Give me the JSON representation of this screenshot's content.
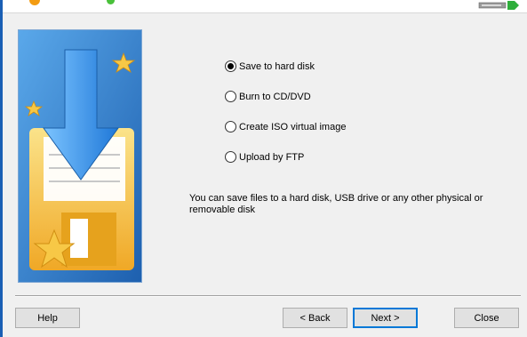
{
  "options": [
    {
      "label": "Save to hard disk",
      "checked": true
    },
    {
      "label": "Burn to CD/DVD",
      "checked": false
    },
    {
      "label": "Create ISO virtual image",
      "checked": false
    },
    {
      "label": "Upload by FTP",
      "checked": false
    }
  ],
  "description": "You can save files to a hard disk, USB drive or any other physical or removable disk",
  "buttons": {
    "help": "Help",
    "back": "< Back",
    "next": "Next >",
    "close": "Close"
  },
  "icons": {
    "illustration": "save-floppy-download-icon",
    "header_drive": "usb-drive-icon"
  },
  "colors": {
    "accent": "#0078d7",
    "art_background": "#2e78c9",
    "floppy": "#f5c33b",
    "arrow": "#2a8ee6",
    "star": "#f7b733"
  }
}
